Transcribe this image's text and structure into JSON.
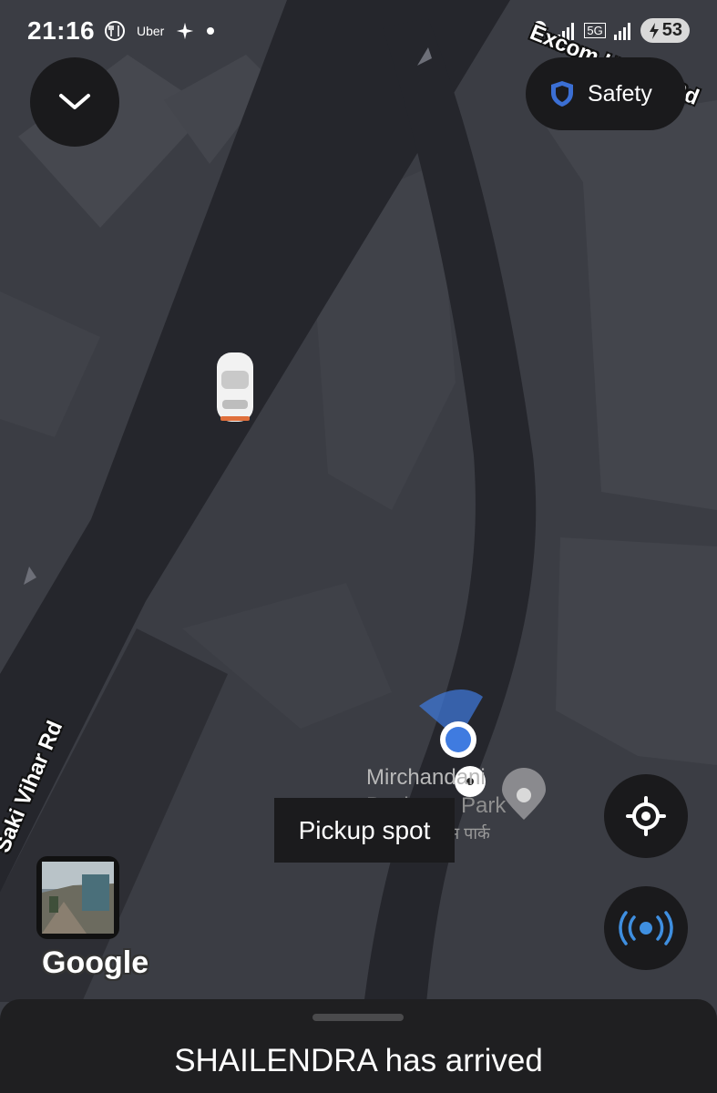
{
  "status_bar": {
    "time": "21:16",
    "uber_label": "Uber",
    "network_label": "5G",
    "battery": "53"
  },
  "buttons": {
    "safety_label": "Safety"
  },
  "map": {
    "road_labels": [
      "Saki Vihar Rd",
      "Excom House Rd"
    ],
    "poi_name": "Mirchandani Business Park",
    "poi_name_line1": "Mirchandani",
    "poi_name_line2": "Business Park",
    "poi_hindi_suffix": "स पार्क",
    "pickup_tooltip": "Pickup spot",
    "attribution": "Google"
  },
  "sheet": {
    "arrival_message": "SHAILENDRA has arrived"
  },
  "colors": {
    "accent_blue": "#3f7be0",
    "map_background": "#3a3c43",
    "road": "#25262c",
    "panel": "#1a1a1c"
  }
}
